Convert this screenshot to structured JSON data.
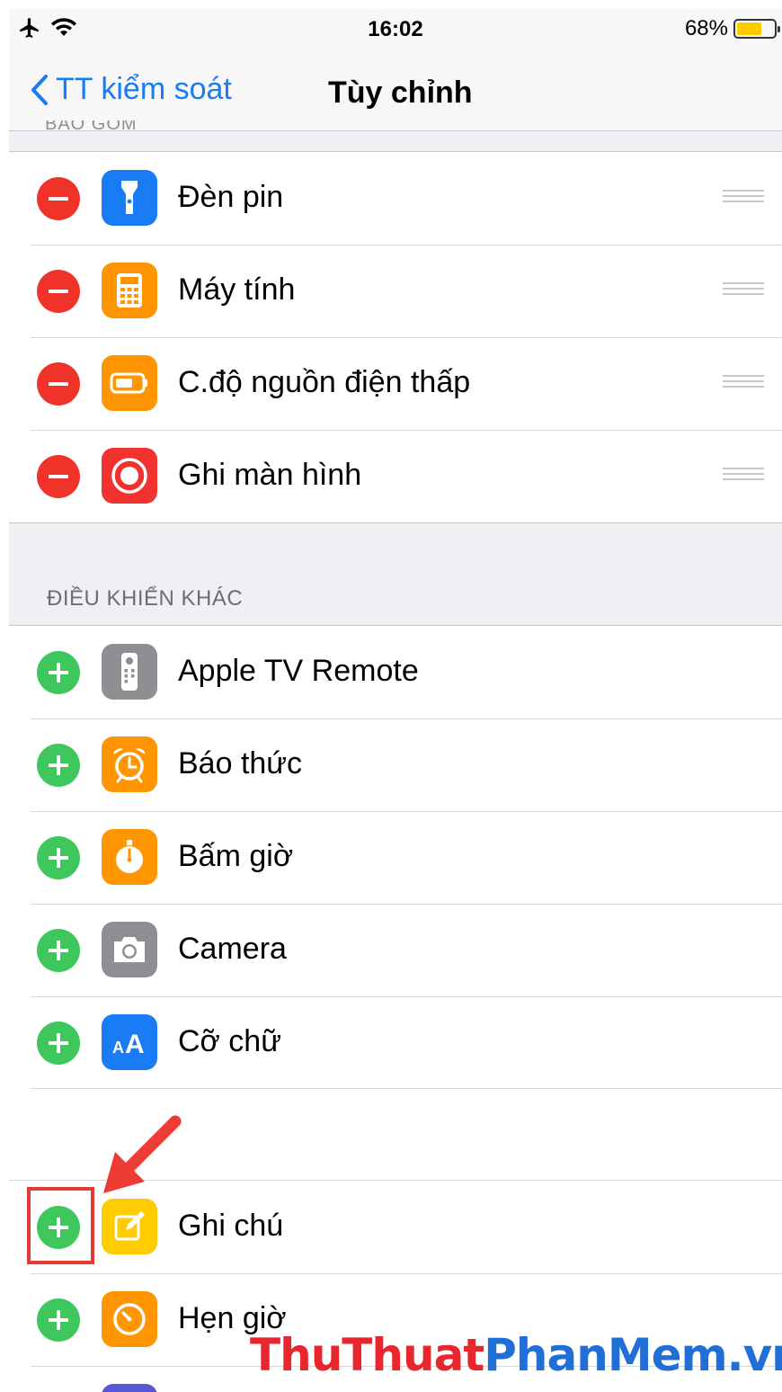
{
  "status": {
    "time": "16:02",
    "battery_percent": "68%",
    "battery_level": 0.68,
    "icons": [
      "airplane-icon",
      "wifi-icon"
    ]
  },
  "nav": {
    "back_label": "TT kiểm soát",
    "title": "Tùy chỉnh",
    "section_above": "BAO GỒM"
  },
  "included": {
    "items": [
      {
        "label": "Đèn pin",
        "icon": "flashlight-icon",
        "color": "#1a7cf5"
      },
      {
        "label": "Máy tính",
        "icon": "calculator-icon",
        "color": "#ff9500"
      },
      {
        "label": "C.độ nguồn điện thấp",
        "icon": "low-power-icon",
        "color": "#ff9500"
      },
      {
        "label": "Ghi màn hình",
        "icon": "screen-record-icon",
        "color": "#f2322e"
      }
    ]
  },
  "more": {
    "header": "ĐIỀU KHIỂN KHÁC",
    "items": [
      {
        "label": "Apple TV Remote",
        "icon": "tv-remote-icon",
        "color": "#8e8e93"
      },
      {
        "label": "Báo thức",
        "icon": "alarm-icon",
        "color": "#ff9500"
      },
      {
        "label": "Bấm giờ",
        "icon": "stopwatch-icon",
        "color": "#ff9500"
      },
      {
        "label": "Camera",
        "icon": "camera-icon",
        "color": "#8e8e93"
      },
      {
        "label": "Cỡ chữ",
        "icon": "text-size-icon",
        "color": "#1a7cf5"
      },
      {
        "label": "Ghi chú",
        "icon": "notes-icon",
        "color": "#ffcc00"
      },
      {
        "label": "Hẹn giờ",
        "icon": "timer-icon",
        "color": "#ff9500"
      }
    ]
  },
  "watermark": {
    "part1": "ThuThuat",
    "part2": "PhanMem.vn"
  }
}
